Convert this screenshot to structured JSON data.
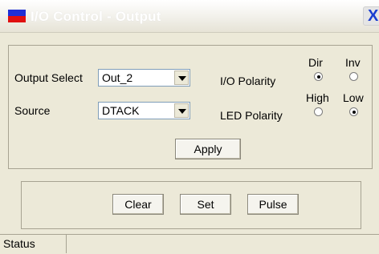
{
  "window": {
    "title": "I/O Control - Output",
    "close_label": "X"
  },
  "output_select": {
    "label": "Output Select",
    "value": "Out_2"
  },
  "source": {
    "label": "Source",
    "value": "DTACK"
  },
  "io_polarity": {
    "label": "I/O Polarity",
    "options": [
      {
        "label": "Dir",
        "selected": true
      },
      {
        "label": "Inv",
        "selected": false
      }
    ]
  },
  "led_polarity": {
    "label": "LED Polarity",
    "options": [
      {
        "label": "High",
        "selected": false
      },
      {
        "label": "Low",
        "selected": true
      }
    ]
  },
  "buttons": {
    "apply": "Apply",
    "clear": "Clear",
    "set": "Set",
    "pulse": "Pulse"
  },
  "status": {
    "label": "Status"
  },
  "colors": {
    "title_text": "#ffffff",
    "icon_blue": "#1f2fd6",
    "icon_red": "#e01010",
    "face": "#ece9d8"
  }
}
